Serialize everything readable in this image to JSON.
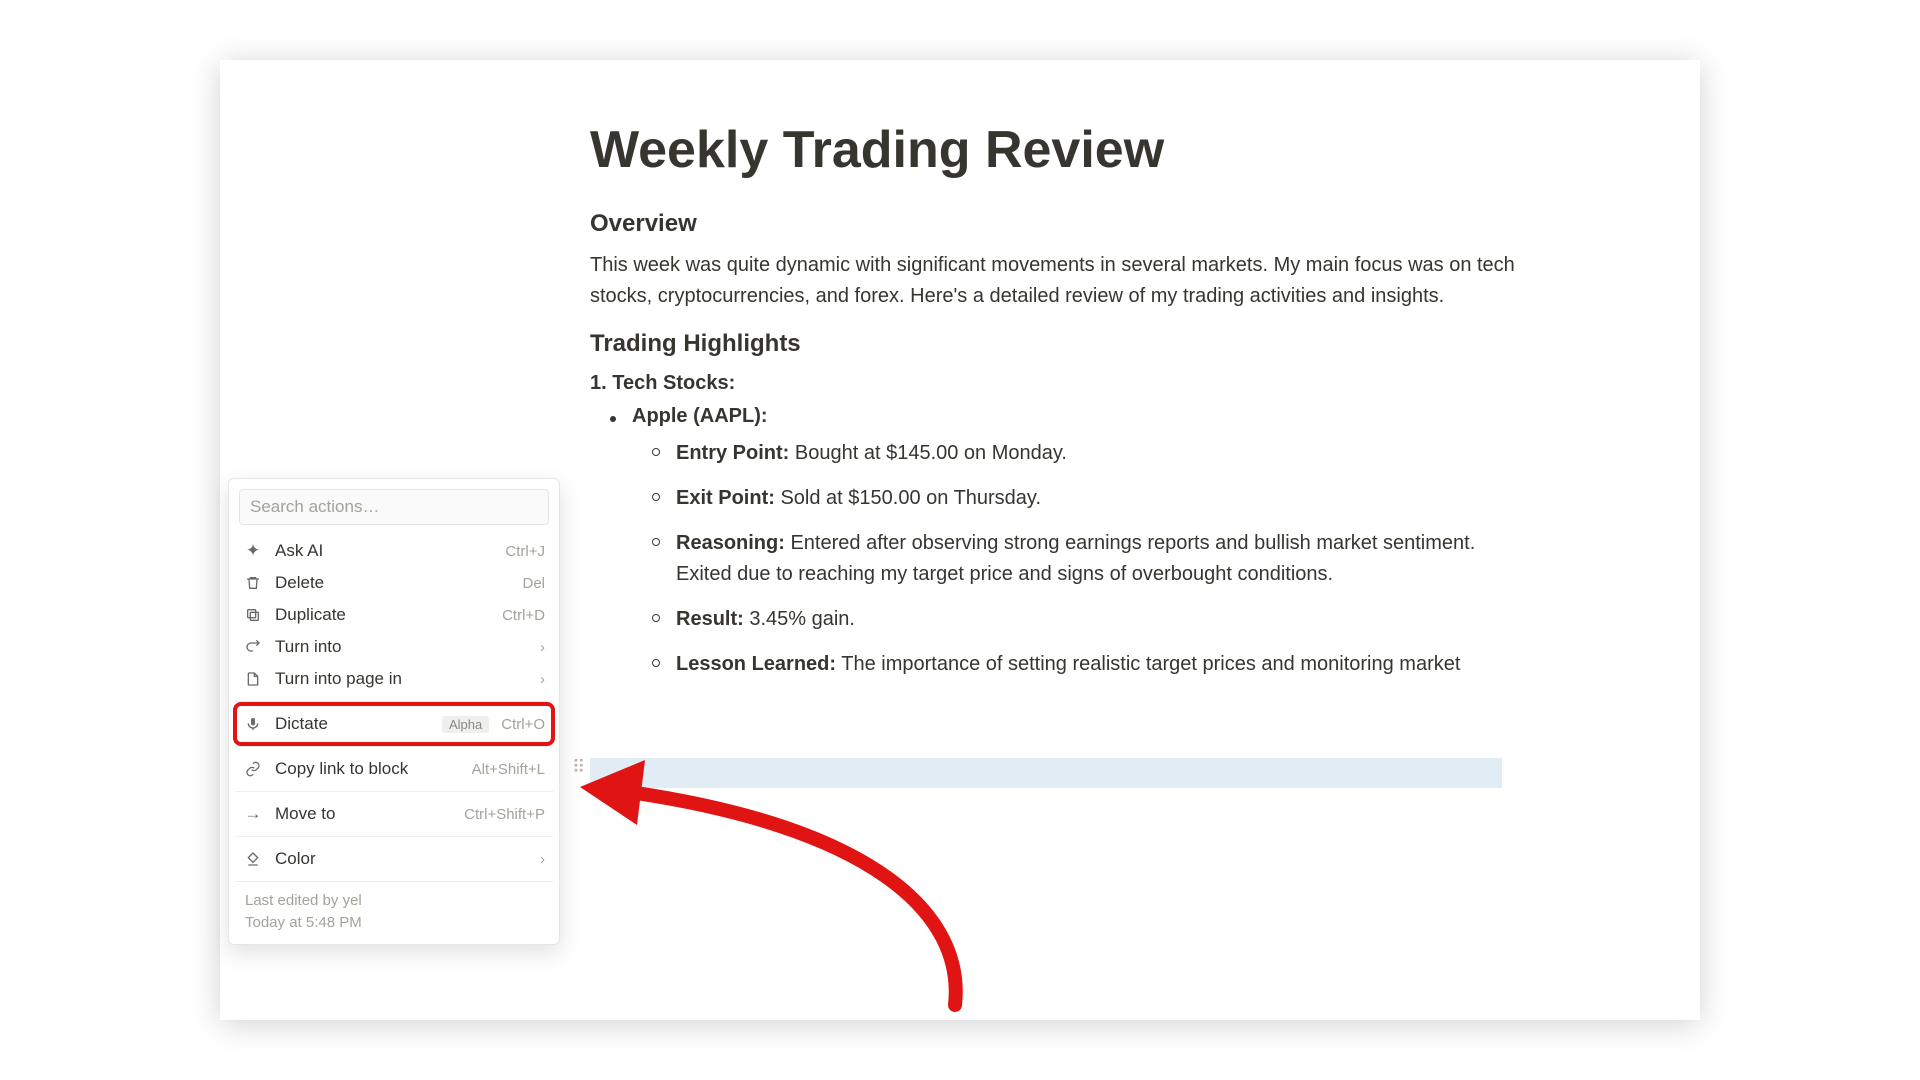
{
  "doc": {
    "title": "Weekly Trading Review",
    "overview_heading": "Overview",
    "overview_text": "This week was quite dynamic with significant movements in several markets. My main focus was on tech stocks, cryptocurrencies, and forex. Here's a detailed review of my trading activities and insights.",
    "highlights_heading": "Trading Highlights",
    "numitem": "1. Tech Stocks:",
    "bullet": "Apple (AAPL):",
    "sub": [
      {
        "label": "Entry Point:",
        "content": " Bought at $145.00 on Monday."
      },
      {
        "label": "Exit Point:",
        "content": " Sold at $150.00 on Thursday."
      },
      {
        "label": "Reasoning:",
        "content": " Entered after observing strong earnings reports and bullish market sentiment. Exited due to reaching my target price and signs of overbought conditions."
      },
      {
        "label": "Result:",
        "content": " 3.45% gain."
      },
      {
        "label": "Lesson Learned:",
        "content": " The importance of setting realistic target prices and monitoring market"
      }
    ]
  },
  "menu": {
    "search_placeholder": "Search actions…",
    "items": [
      {
        "icon": "sparkle",
        "label": "Ask AI",
        "short": "Ctrl+J"
      },
      {
        "icon": "trash",
        "label": "Delete",
        "short": "Del"
      },
      {
        "icon": "dup",
        "label": "Duplicate",
        "short": "Ctrl+D"
      },
      {
        "icon": "turn",
        "label": "Turn into",
        "chev": true
      },
      {
        "icon": "page",
        "label": "Turn into page in",
        "chev": true
      },
      {
        "icon": "mic",
        "label": "Dictate",
        "badge": "Alpha",
        "short": "Ctrl+O",
        "highlight": true
      },
      {
        "icon": "link",
        "label": "Copy link to block",
        "short": "Alt+Shift+L"
      },
      {
        "icon": "move",
        "label": "Move to",
        "short": "Ctrl+Shift+P"
      },
      {
        "icon": "color",
        "label": "Color",
        "chev": true
      }
    ],
    "footer_line1": "Last edited by yel",
    "footer_line2": "Today at 5:48 PM"
  }
}
